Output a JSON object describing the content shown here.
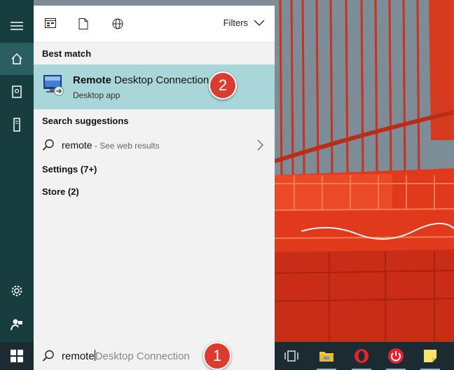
{
  "rail": {
    "items": [
      {
        "icon": "hamburger-menu-icon"
      },
      {
        "icon": "home-icon",
        "active": true
      },
      {
        "icon": "notebook-icon"
      },
      {
        "icon": "device-icon"
      },
      {
        "icon": "settings-gear-icon"
      },
      {
        "icon": "feedback-icon"
      }
    ]
  },
  "filter_bar": {
    "icons": [
      "apps-filter-icon",
      "documents-filter-icon",
      "web-filter-icon"
    ],
    "filters_label": "Filters"
  },
  "results": {
    "best_match_header": "Best match",
    "best_match": {
      "title_bold": "Remote",
      "title_rest": " Desktop Connection",
      "subtitle": "Desktop app",
      "icon": "remote-desktop-icon"
    },
    "suggestions_header": "Search suggestions",
    "suggestion": {
      "query": "remote",
      "hint": " - See web results"
    },
    "settings_header": "Settings (7+)",
    "store_header": "Store (2)"
  },
  "search": {
    "typed": "remote",
    "autocomplete": "Desktop Connection"
  },
  "taskbar": {
    "icons": [
      "task-view-icon",
      "file-explorer-icon",
      "opera-browser-icon",
      "power-app-icon",
      "sticky-notes-icon"
    ]
  },
  "callouts": {
    "step1": "1",
    "step2": "2"
  },
  "colors": {
    "rail_bg": "#173d3f",
    "rail_active": "#2a5e60",
    "best_match_highlight": "#a9d6d8",
    "callout": "#dd3b30"
  }
}
